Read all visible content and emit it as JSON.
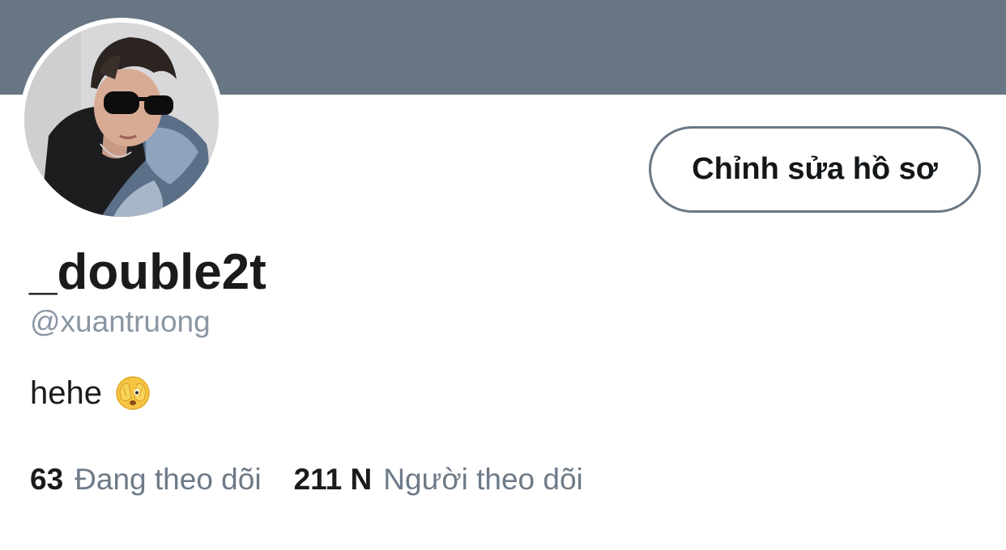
{
  "profile": {
    "display_name": "_double2t",
    "handle": "@xuantruong",
    "bio_text": "hehe",
    "bio_emoji": "face-with-peeking-eye-emoji",
    "avatar": "profile-photo-person-sunglasses"
  },
  "actions": {
    "edit_profile_label": "Chỉnh sửa hồ sơ"
  },
  "stats": {
    "following_count": "63",
    "following_label": "Đang theo dõi",
    "followers_count": "211 N",
    "followers_label": "Người theo dõi"
  },
  "colors": {
    "banner": "#687684",
    "button_border": "#6a7785",
    "secondary_text": "#8a96a3",
    "primary_text": "#1b1b1b"
  }
}
